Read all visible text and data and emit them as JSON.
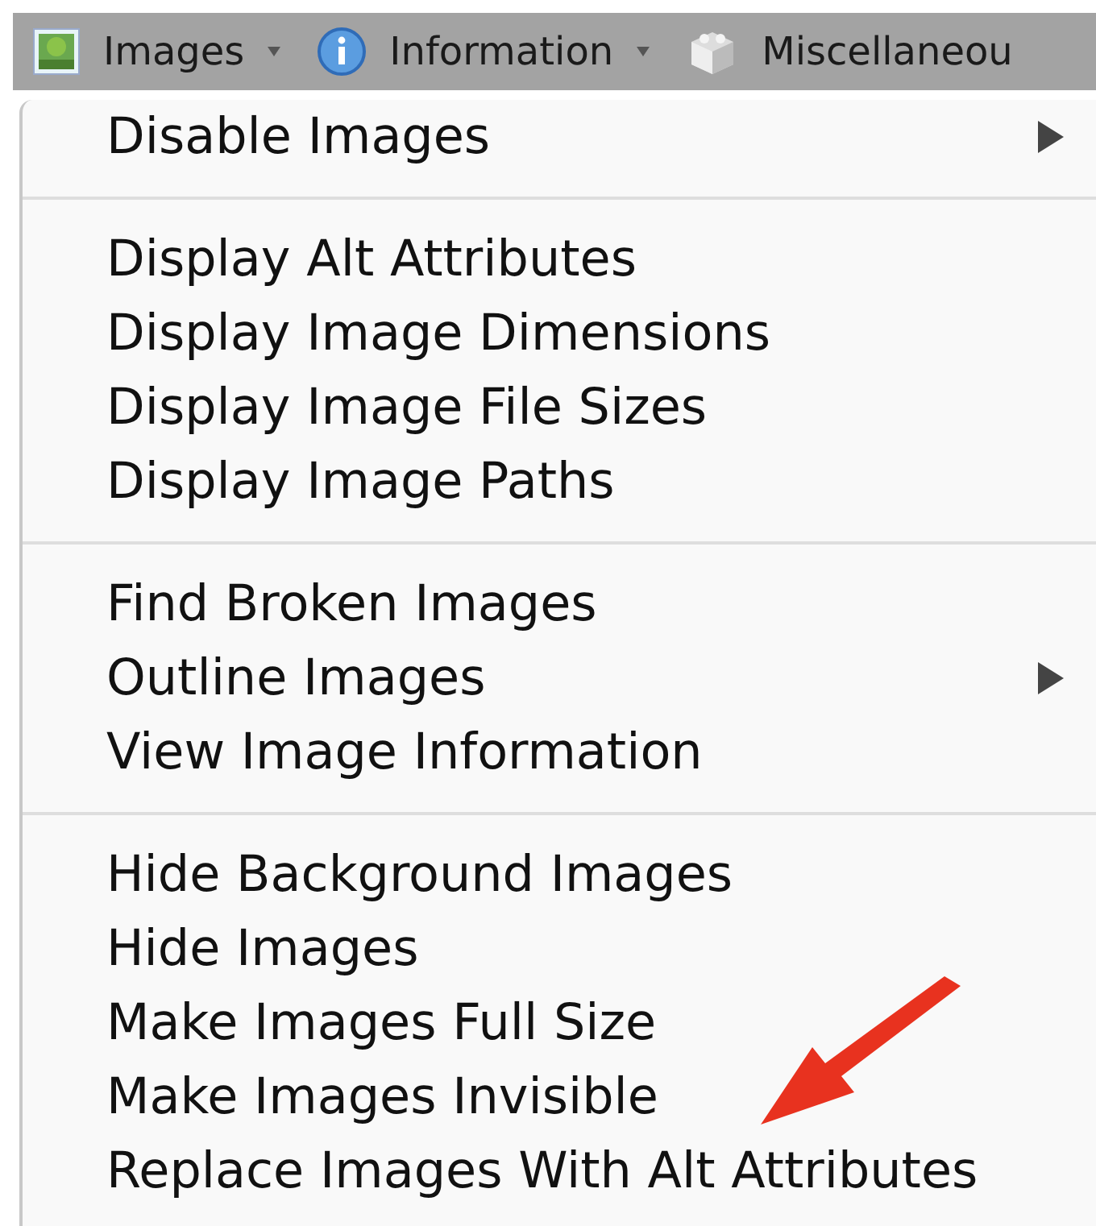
{
  "toolbar": [
    {
      "label": "Images",
      "kind": "image",
      "dropdown": true
    },
    {
      "label": "Information",
      "kind": "info",
      "dropdown": true
    },
    {
      "label": "Miscellaneou",
      "kind": "blocks",
      "dropdown": false
    }
  ],
  "menu": {
    "groups": [
      {
        "items": [
          {
            "label": "Disable Images",
            "submenu": true
          }
        ]
      },
      {
        "items": [
          {
            "label": "Display Alt Attributes",
            "submenu": false
          },
          {
            "label": "Display Image Dimensions",
            "submenu": false
          },
          {
            "label": "Display Image File Sizes",
            "submenu": false
          },
          {
            "label": "Display Image Paths",
            "submenu": false
          }
        ]
      },
      {
        "items": [
          {
            "label": "Find Broken Images",
            "submenu": false
          },
          {
            "label": "Outline Images",
            "submenu": true
          },
          {
            "label": "View Image Information",
            "submenu": false
          }
        ]
      },
      {
        "items": [
          {
            "label": "Hide Background Images",
            "submenu": false
          },
          {
            "label": "Hide Images",
            "submenu": false
          },
          {
            "label": "Make Images Full Size",
            "submenu": false
          },
          {
            "label": "Make Images Invisible",
            "submenu": false
          },
          {
            "label": "Replace Images With Alt Attributes",
            "submenu": false
          }
        ]
      }
    ]
  }
}
